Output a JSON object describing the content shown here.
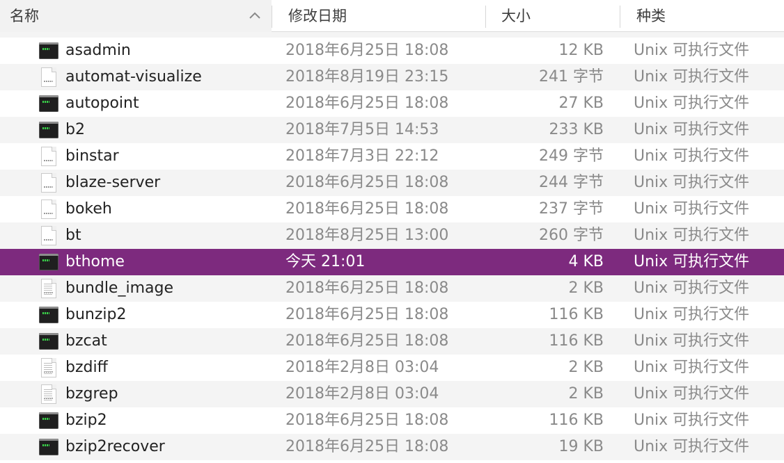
{
  "header": {
    "name_label": "名称",
    "date_label": "修改日期",
    "size_label": "大小",
    "kind_label": "种类"
  },
  "files": [
    {
      "name": "asadmin",
      "date": "2018年6月25日 18:08",
      "size": "12 KB",
      "kind": "Unix 可执行文件",
      "icon": "terminal-exec-icon"
    },
    {
      "name": "automat-visualize",
      "date": "2018年8月19日 23:15",
      "size": "241 字节",
      "kind": "Unix 可执行文件",
      "icon": "script-doc-icon"
    },
    {
      "name": "autopoint",
      "date": "2018年6月25日 18:08",
      "size": "27 KB",
      "kind": "Unix 可执行文件",
      "icon": "terminal-exec-icon"
    },
    {
      "name": "b2",
      "date": "2018年7月5日 14:53",
      "size": "233 KB",
      "kind": "Unix 可执行文件",
      "icon": "terminal-exec-icon"
    },
    {
      "name": "binstar",
      "date": "2018年7月3日 22:12",
      "size": "249 字节",
      "kind": "Unix 可执行文件",
      "icon": "script-doc-icon"
    },
    {
      "name": "blaze-server",
      "date": "2018年6月25日 18:08",
      "size": "244 字节",
      "kind": "Unix 可执行文件",
      "icon": "script-doc-icon"
    },
    {
      "name": "bokeh",
      "date": "2018年6月25日 18:08",
      "size": "237 字节",
      "kind": "Unix 可执行文件",
      "icon": "script-doc-icon"
    },
    {
      "name": "bt",
      "date": "2018年8月25日 13:00",
      "size": "260 字节",
      "kind": "Unix 可执行文件",
      "icon": "script-doc-icon"
    },
    {
      "name": "bthome",
      "date": "今天 21:01",
      "size": "4 KB",
      "kind": "Unix 可执行文件",
      "icon": "terminal-exec-icon",
      "selected": true
    },
    {
      "name": "bundle_image",
      "date": "2018年6月25日 18:08",
      "size": "2 KB",
      "kind": "Unix 可执行文件",
      "icon": "text-doc-icon"
    },
    {
      "name": "bunzip2",
      "date": "2018年6月25日 18:08",
      "size": "116 KB",
      "kind": "Unix 可执行文件",
      "icon": "terminal-exec-icon"
    },
    {
      "name": "bzcat",
      "date": "2018年6月25日 18:08",
      "size": "116 KB",
      "kind": "Unix 可执行文件",
      "icon": "terminal-exec-icon"
    },
    {
      "name": "bzdiff",
      "date": "2018年2月8日 03:04",
      "size": "2 KB",
      "kind": "Unix 可执行文件",
      "icon": "text-doc-icon"
    },
    {
      "name": "bzgrep",
      "date": "2018年2月8日 03:04",
      "size": "2 KB",
      "kind": "Unix 可执行文件",
      "icon": "text-doc-icon"
    },
    {
      "name": "bzip2",
      "date": "2018年6月25日 18:08",
      "size": "116 KB",
      "kind": "Unix 可执行文件",
      "icon": "terminal-exec-icon"
    },
    {
      "name": "bzip2recover",
      "date": "2018年6月25日 18:08",
      "size": "19 KB",
      "kind": "Unix 可执行文件",
      "icon": "terminal-exec-icon"
    }
  ]
}
